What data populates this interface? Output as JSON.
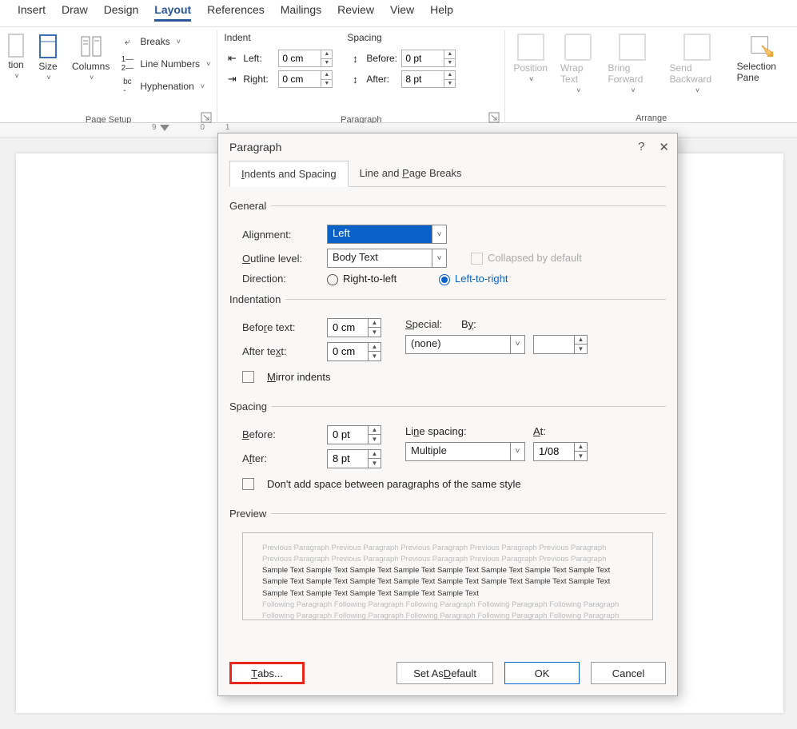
{
  "menu": {
    "items": [
      "Insert",
      "Draw",
      "Design",
      "Layout",
      "References",
      "Mailings",
      "Review",
      "View",
      "Help"
    ],
    "active": 3
  },
  "ribbon": {
    "pageSetup": {
      "label": "Page Setup",
      "big": [
        "tion",
        "Size",
        "Columns"
      ],
      "breaks": "Breaks",
      "lineNumbers": "Line Numbers",
      "hyphenation": "Hyphenation"
    },
    "paragraph": {
      "label": "Paragraph",
      "indentTitle": "Indent",
      "spacingTitle": "Spacing",
      "left": "Left:",
      "right": "Right:",
      "before": "Before:",
      "after": "After:",
      "leftVal": "0 cm",
      "rightVal": "0 cm",
      "beforeVal": "0 pt",
      "afterVal": "8 pt"
    },
    "arrange": {
      "label": "Arrange",
      "position": "Position",
      "wrap": "Wrap Text",
      "bringForward": "Bring Forward",
      "sendBackward": "Send Backward",
      "selectionPane": "Selection Pane"
    }
  },
  "dialog": {
    "title": "Paragraph",
    "tabs": [
      "Indents and Spacing",
      "Line and Page Breaks"
    ],
    "general": "General",
    "alignment": "Alignment:",
    "alignmentVal": "Left",
    "outline": "Outline level:",
    "outlineVal": "Body Text",
    "collapsed": "Collapsed by default",
    "direction": "Direction:",
    "rtl": "Right-to-left",
    "ltr": "Left-to-right",
    "indentation": "Indentation",
    "beforeText": "Before text:",
    "afterText": "After text:",
    "beforeTextVal": "0 cm",
    "afterTextVal": "0 cm",
    "special": "Special:",
    "specialVal": "(none)",
    "by": "By:",
    "mirror": "Mirror indents",
    "spacing": "Spacing",
    "before": "Before:",
    "after": "After:",
    "beforeVal": "0 pt",
    "afterVal": "8 pt",
    "lineSpacing": "Line spacing:",
    "lineVal": "Multiple",
    "at": "At:",
    "atVal": "1/08",
    "noSpace": "Don't add space between paragraphs of the same style",
    "previewLabel": "Preview",
    "previewPrev": "Previous Paragraph Previous Paragraph Previous Paragraph Previous Paragraph Previous Paragraph Previous Paragraph Previous Paragraph Previous Paragraph Previous Paragraph Previous Paragraph",
    "previewSample": "Sample Text Sample Text Sample Text Sample Text Sample Text Sample Text Sample Text Sample Text Sample Text Sample Text Sample Text Sample Text Sample Text Sample Text Sample Text Sample Text Sample Text Sample Text Sample Text Sample Text Sample Text",
    "previewNext": "Following Paragraph Following Paragraph Following Paragraph Following Paragraph Following Paragraph Following Paragraph Following Paragraph Following Paragraph Following Paragraph Following Paragraph",
    "tabsBtn": "Tabs...",
    "setDefault": "Set As Default",
    "ok": "OK",
    "cancel": "Cancel"
  },
  "ruler": "      9         01"
}
